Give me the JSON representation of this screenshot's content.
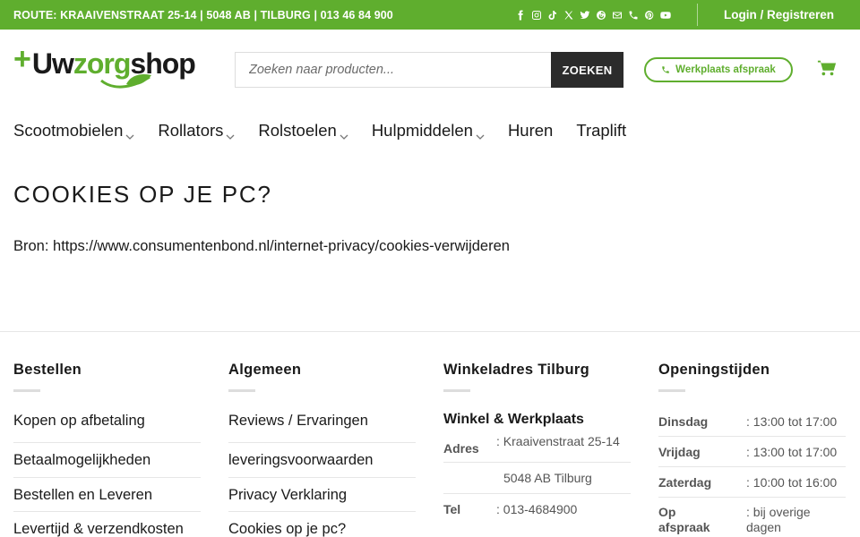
{
  "topbar": {
    "route": "ROUTE: KRAAIVENSTRAAT 25-14 | 5048 AB | TILBURG | 013 46 84 900",
    "socials": [
      "facebook-icon",
      "instagram-icon",
      "tiktok-icon",
      "x-icon",
      "twitter-icon",
      "threads-icon",
      "email-icon",
      "phone-icon",
      "pinterest-icon",
      "youtube-icon"
    ],
    "login": "Login / Registreren"
  },
  "logo": {
    "plus": "+",
    "uw": "Uw",
    "zorg": "zorg",
    "shop": "shop"
  },
  "search": {
    "placeholder": "Zoeken naar producten...",
    "button": "ZOEKEN"
  },
  "appointment": {
    "label": "Werkplaats afspraak"
  },
  "nav": {
    "items": [
      {
        "label": "Scootmobielen",
        "has_dropdown": true
      },
      {
        "label": "Rollators",
        "has_dropdown": true
      },
      {
        "label": "Rolstoelen",
        "has_dropdown": true
      },
      {
        "label": "Hulpmiddelen",
        "has_dropdown": true
      },
      {
        "label": "Huren",
        "has_dropdown": false
      },
      {
        "label": "Traplift",
        "has_dropdown": false
      }
    ]
  },
  "main": {
    "title": "COOKIES OP JE PC?",
    "source": "Bron: https://www.consumentenbond.nl/internet-privacy/cookies-verwijderen"
  },
  "footer": {
    "bestellen": {
      "title": "Bestellen",
      "links": [
        "Kopen op afbetaling",
        "Betaalmogelijkheden",
        "Bestellen en Leveren",
        "Levertijd & verzendkosten"
      ]
    },
    "algemeen": {
      "title": "Algemeen",
      "links": [
        "Reviews / Ervaringen",
        "leveringsvoorwaarden",
        "Privacy Verklaring",
        "Cookies op je pc?"
      ]
    },
    "winkel": {
      "title": "Winkeladres Tilburg",
      "subtitle": "Winkel & Werkplaats",
      "address_label": "Adres",
      "address_line1": ": Kraaivenstraat 25-14",
      "address_line2": "5048 AB Tilburg",
      "tel_label": "Tel",
      "tel_value": ": 013-4684900"
    },
    "openingstijden": {
      "title": "Openingstijden",
      "rows": [
        {
          "day": "Dinsdag",
          "time": ": 13:00 tot 17:00"
        },
        {
          "day": "Vrijdag",
          "time": ": 13:00 tot 17:00"
        },
        {
          "day": "Zaterdag",
          "time": ": 10:00 tot 16:00"
        },
        {
          "day": "Op afspraak",
          "time": ": bij overige dagen"
        }
      ]
    }
  },
  "colors": {
    "brand_green": "#5fae2e",
    "dark": "#2b2b2b"
  }
}
